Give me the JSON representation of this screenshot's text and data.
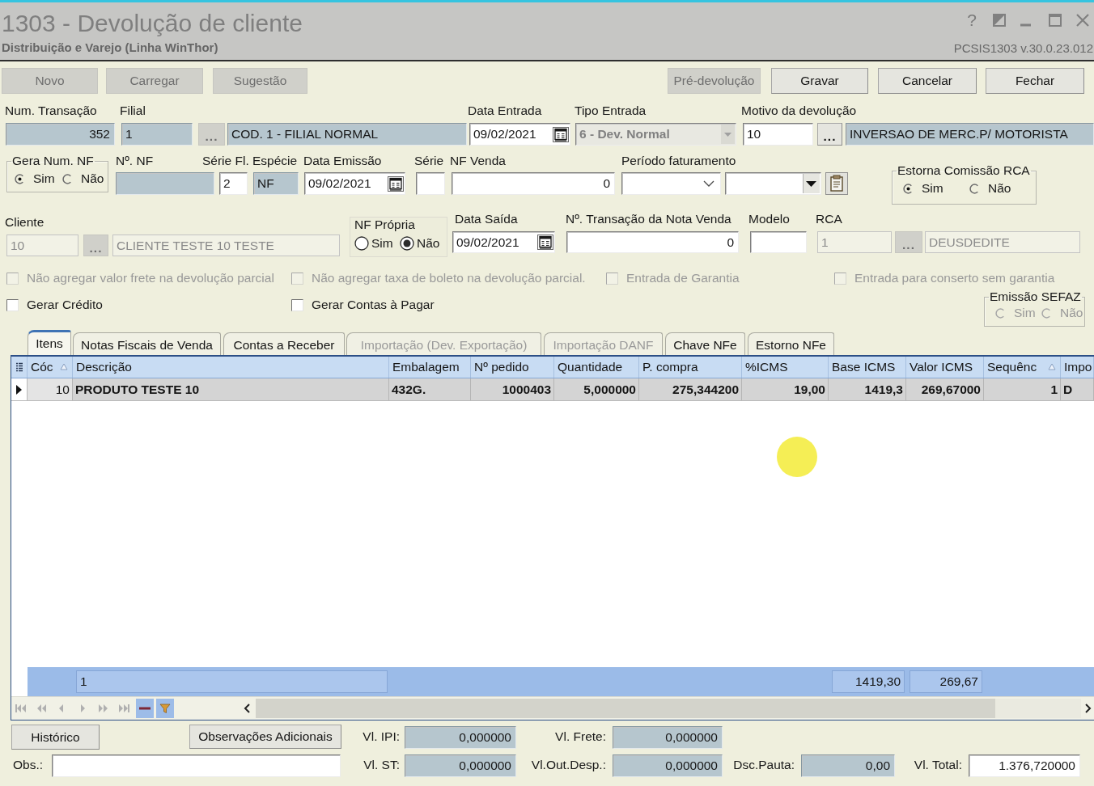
{
  "window": {
    "title": "1303 - Devolução de cliente",
    "subtitle": "Distribuição e Varejo (Linha WinThor)",
    "help": "?",
    "version": "PCSIS1303 v.30.0.23.012"
  },
  "toolbar": {
    "left": [
      {
        "label": "Novo",
        "disabled": true
      },
      {
        "label": "Carregar",
        "disabled": true
      },
      {
        "label": "Sugestão",
        "disabled": true
      }
    ],
    "right": [
      {
        "label": "Pré-devolução",
        "disabled": true
      },
      {
        "label": "Gravar",
        "disabled": false
      },
      {
        "label": "Cancelar",
        "disabled": false
      },
      {
        "label": "Fechar",
        "disabled": false
      }
    ]
  },
  "transaction": {
    "label": "Num. Transação",
    "value": "352",
    "readonly": true
  },
  "filial": {
    "label": "Filial",
    "code": {
      "value": "1",
      "readonly": true
    },
    "lookup": {
      "label": "...",
      "disabled": true
    },
    "name": {
      "value": "COD. 1 - FILIAL NORMAL",
      "readonly": true
    }
  },
  "data_entrada": {
    "label": "Data Entrada",
    "value": "09/02/2021"
  },
  "tipo_entrada": {
    "label": "Tipo Entrada",
    "value": "6 - Dev. Normal",
    "disabled": true
  },
  "motivo": {
    "label": "Motivo da devolução",
    "code": {
      "value": "10",
      "readonly": false
    },
    "lookup": {
      "label": "...",
      "disabled": false
    },
    "name": {
      "value": "INVERSAO DE MERC.P/ MOTORISTA",
      "readonly": true
    }
  },
  "gera_num_nf": {
    "label": "Gera Num. NF",
    "options": [
      {
        "label": "Sim",
        "selected": true
      },
      {
        "label": "Não",
        "selected": false
      }
    ]
  },
  "numero_nf": {
    "label": "Nº. NF",
    "readonly": true
  },
  "serie_fl": {
    "label": "Série Fl.",
    "value": "2",
    "readonly": false
  },
  "especie": {
    "label": "Espécie",
    "value": "NF",
    "readonly": true
  },
  "data_emissao": {
    "label": "Data Emissão",
    "value": "09/02/2021"
  },
  "serie": {
    "label": "Série",
    "readonly": false
  },
  "nf_venda": {
    "label": "NF Venda",
    "value": "0",
    "readonly": false
  },
  "periodo_faturamento": {
    "label": "Período faturamento"
  },
  "estorna_comissao": {
    "label": "Estorna Comissão RCA",
    "options": [
      {
        "label": "Sim",
        "selected": true
      },
      {
        "label": "Não",
        "selected": false
      }
    ]
  },
  "cliente": {
    "label": "Cliente",
    "code": {
      "value": "10",
      "disabled": true
    },
    "lookup": {
      "label": "...",
      "disabled": true
    },
    "name": {
      "value": "CLIENTE TESTE 10 TESTE",
      "disabled": true
    }
  },
  "nf_propria": {
    "label": "NF Própria",
    "options": [
      {
        "label": "Sim",
        "selected": false
      },
      {
        "label": "Não",
        "selected": true
      }
    ]
  },
  "data_saida": {
    "label": "Data Saída",
    "value": "09/02/2021"
  },
  "transacao_nota_venda": {
    "label": "Nº. Transação da Nota Venda",
    "value": "0",
    "readonly": false
  },
  "modelo": {
    "label": "Modelo",
    "readonly": false
  },
  "rca": {
    "label": "RCA",
    "code": {
      "value": "1",
      "disabled": true
    },
    "lookup": {
      "label": "...",
      "disabled": true
    },
    "name": {
      "value": "DEUSDEDITE",
      "disabled": true
    }
  },
  "options": [
    [
      {
        "label": "Não agregar valor frete na devolução parcial",
        "checked": false,
        "disabled": true
      },
      {
        "label": "Não agregar taxa de boleto na devolução parcial.",
        "checked": false,
        "disabled": true
      },
      {
        "label": "Entrada de Garantia",
        "checked": false,
        "disabled": true
      },
      {
        "label": "Entrada para conserto sem garantia",
        "checked": false,
        "disabled": true
      }
    ],
    [
      {
        "label": "Gerar Crédito",
        "checked": false,
        "disabled": false
      },
      {
        "label": "Gerar Contas à Pagar",
        "checked": false,
        "disabled": false
      }
    ]
  ],
  "emissao_sefaz": {
    "label": "Emissão SEFAZ",
    "disabled": true,
    "options": [
      {
        "label": "Sim",
        "selected": false
      },
      {
        "label": "Não",
        "selected": false
      }
    ]
  },
  "tabs": [
    {
      "label": "Itens",
      "selected": true,
      "disabled": false
    },
    {
      "label": "Notas Fiscais de Venda",
      "selected": false,
      "disabled": false
    },
    {
      "label": "Contas a Receber",
      "selected": false,
      "disabled": false
    },
    {
      "label": "Importação (Dev. Exportação)",
      "selected": false,
      "disabled": true
    },
    {
      "label": "Importação DANF",
      "selected": false,
      "disabled": true
    },
    {
      "label": "Chave NFe",
      "selected": false,
      "disabled": false
    },
    {
      "label": "Estorno NFe",
      "selected": false,
      "disabled": false
    }
  ],
  "grid": {
    "columns": [
      {
        "label": "Cóc",
        "kind": "key",
        "sorted": true
      },
      {
        "label": "Descrição",
        "kind": "text",
        "sorted": false,
        "total": "1"
      },
      {
        "label": "Embalagem",
        "kind": "text",
        "sorted": false
      },
      {
        "label": "Nº pedido",
        "kind": "number",
        "sorted": false
      },
      {
        "label": "Quantidade",
        "kind": "number",
        "sorted": false
      },
      {
        "label": "P. compra",
        "kind": "number",
        "sorted": false
      },
      {
        "label": "%ICMS",
        "kind": "number",
        "sorted": false
      },
      {
        "label": "Base ICMS",
        "kind": "number",
        "sorted": false,
        "total": "1419,30"
      },
      {
        "label": "Valor ICMS",
        "kind": "number",
        "sorted": false,
        "total": "269,67"
      },
      {
        "label": "Sequênc",
        "kind": "number",
        "sorted": true
      },
      {
        "label": "Impo",
        "kind": "text",
        "sorted": false
      }
    ],
    "rows": [
      {
        "selected": true,
        "cells": [
          "10",
          "PRODUTO TESTE 10",
          "432G.",
          "1000403",
          "5,000000",
          "275,344200",
          "19,00",
          "1419,3",
          "269,67000",
          "1",
          "D"
        ]
      }
    ],
    "navigator": [
      {
        "kind": "first",
        "disabled": true
      },
      {
        "kind": "prior_page",
        "disabled": true
      },
      {
        "kind": "prior",
        "disabled": true
      },
      {
        "kind": "next",
        "disabled": true
      },
      {
        "kind": "next_page",
        "disabled": true
      },
      {
        "kind": "last",
        "disabled": true
      },
      {
        "kind": "delete",
        "disabled": false
      },
      {
        "kind": "filter",
        "disabled": false
      }
    ]
  },
  "buttons": [
    {
      "label": "Histórico"
    },
    {
      "label": "Observações Adicionais"
    }
  ],
  "obs": {
    "label": "Obs.:"
  },
  "totals": [
    [
      {
        "label": "Vl. IPI:",
        "value": "0,000000",
        "readonly": true
      },
      {
        "label": "Vl. Frete:",
        "value": "0,000000",
        "readonly": true
      }
    ],
    [
      {
        "label": "Vl. ST:",
        "value": "0,000000",
        "readonly": true
      },
      {
        "label": "Vl.Out.Desp.:",
        "value": "0,000000",
        "readonly": true
      },
      {
        "label": "Dsc.Pauta:",
        "value": "0,00",
        "readonly": true
      },
      {
        "label": "Vl. Total:",
        "value": "1.376,720000",
        "readonly": false
      }
    ]
  ]
}
